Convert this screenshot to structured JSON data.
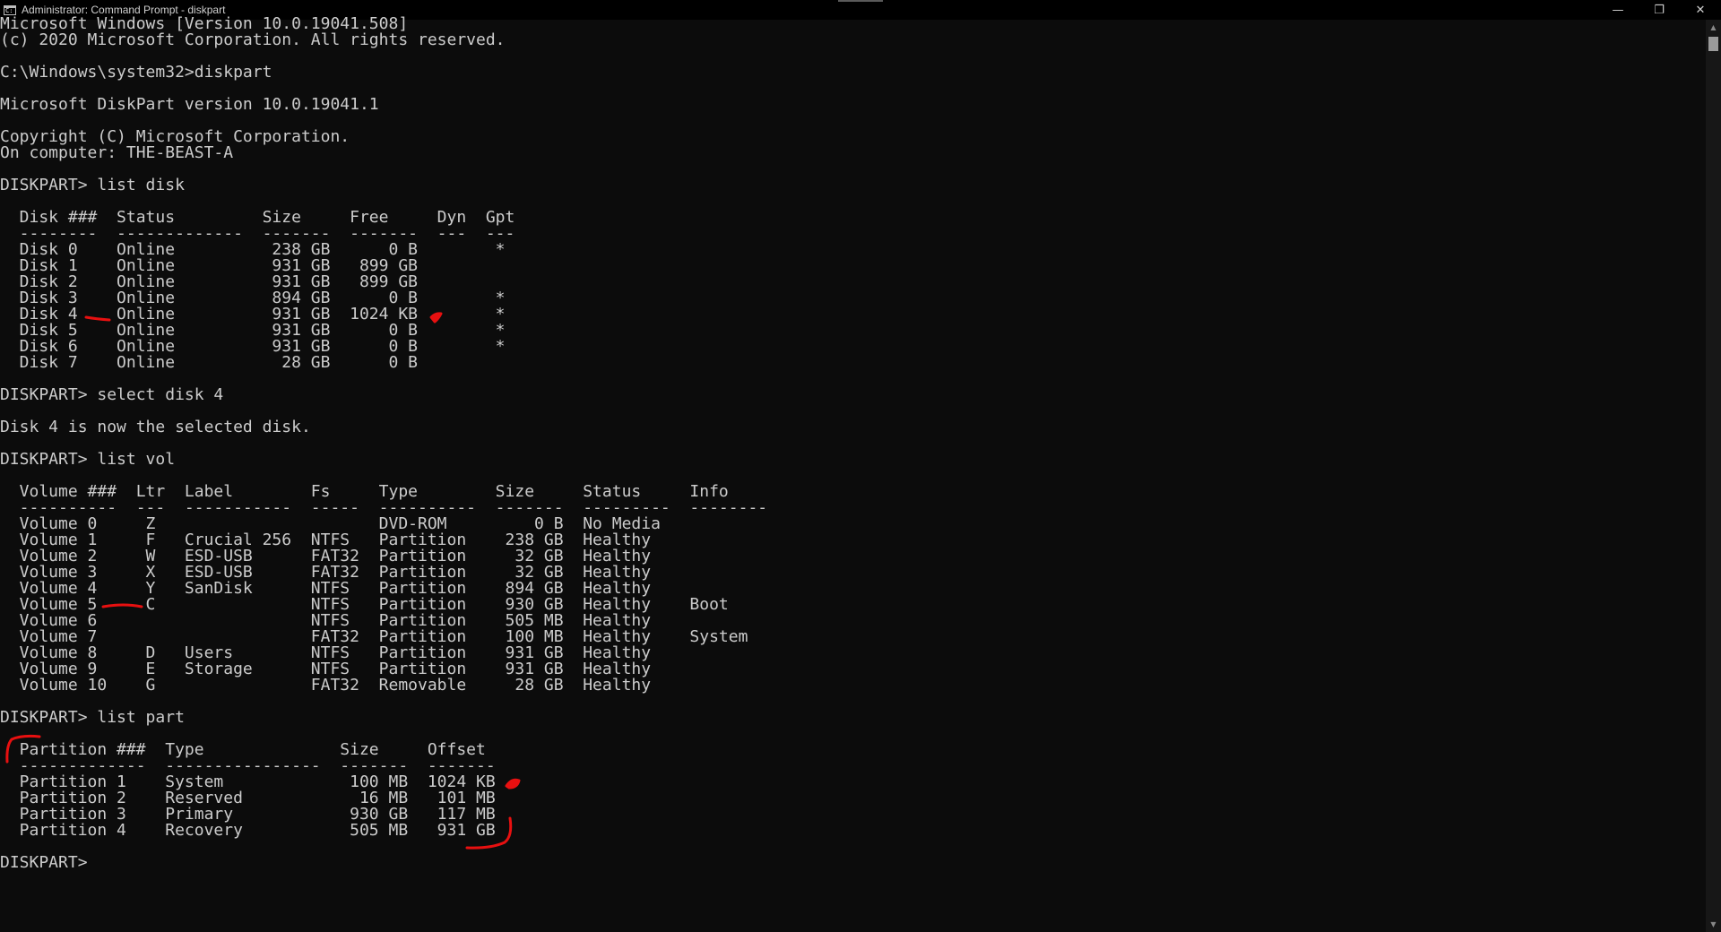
{
  "window": {
    "title": "Administrator: Command Prompt - diskpart",
    "controls": {
      "minimize": "—",
      "restore": "❐",
      "close": "✕"
    }
  },
  "console": {
    "lines": [
      "Microsoft Windows [Version 10.0.19041.508]",
      "(c) 2020 Microsoft Corporation. All rights reserved.",
      "",
      "C:\\Windows\\system32>diskpart",
      "",
      "Microsoft DiskPart version 10.0.19041.1",
      "",
      "Copyright (C) Microsoft Corporation.",
      "On computer: THE-BEAST-A",
      "",
      "DISKPART> list disk",
      "",
      "  Disk ###  Status         Size     Free     Dyn  Gpt",
      "  --------  -------------  -------  -------  ---  ---",
      "  Disk 0    Online          238 GB      0 B        *",
      "  Disk 1    Online          931 GB   899 GB",
      "  Disk 2    Online          931 GB   899 GB",
      "  Disk 3    Online          894 GB      0 B        *",
      "  Disk 4    Online          931 GB  1024 KB        *",
      "  Disk 5    Online          931 GB      0 B        *",
      "  Disk 6    Online          931 GB      0 B        *",
      "  Disk 7    Online           28 GB      0 B",
      "",
      "DISKPART> select disk 4",
      "",
      "Disk 4 is now the selected disk.",
      "",
      "DISKPART> list vol",
      "",
      "  Volume ###  Ltr  Label        Fs     Type        Size     Status     Info",
      "  ----------  ---  -----------  -----  ----------  -------  ---------  --------",
      "  Volume 0     Z                       DVD-ROM         0 B  No Media",
      "  Volume 1     F   Crucial 256  NTFS   Partition    238 GB  Healthy",
      "  Volume 2     W   ESD-USB      FAT32  Partition     32 GB  Healthy",
      "  Volume 3     X   ESD-USB      FAT32  Partition     32 GB  Healthy",
      "  Volume 4     Y   SanDisk      NTFS   Partition    894 GB  Healthy",
      "  Volume 5     C                NTFS   Partition    930 GB  Healthy    Boot",
      "  Volume 6                      NTFS   Partition    505 MB  Healthy",
      "  Volume 7                      FAT32  Partition    100 MB  Healthy    System",
      "  Volume 8     D   Users        NTFS   Partition    931 GB  Healthy",
      "  Volume 9     E   Storage      NTFS   Partition    931 GB  Healthy",
      "  Volume 10    G                FAT32  Removable     28 GB  Healthy",
      "",
      "DISKPART> list part",
      "",
      "  Partition ###  Type              Size     Offset",
      "  -------------  ----------------  -------  -------",
      "  Partition 1    System             100 MB  1024 KB",
      "  Partition 2    Reserved            16 MB   101 MB",
      "  Partition 3    Primary            930 GB   117 MB",
      "  Partition 4    Recovery           505 MB   931 GB",
      "",
      "DISKPART>"
    ]
  },
  "annotations": {
    "color": "#e81010"
  }
}
